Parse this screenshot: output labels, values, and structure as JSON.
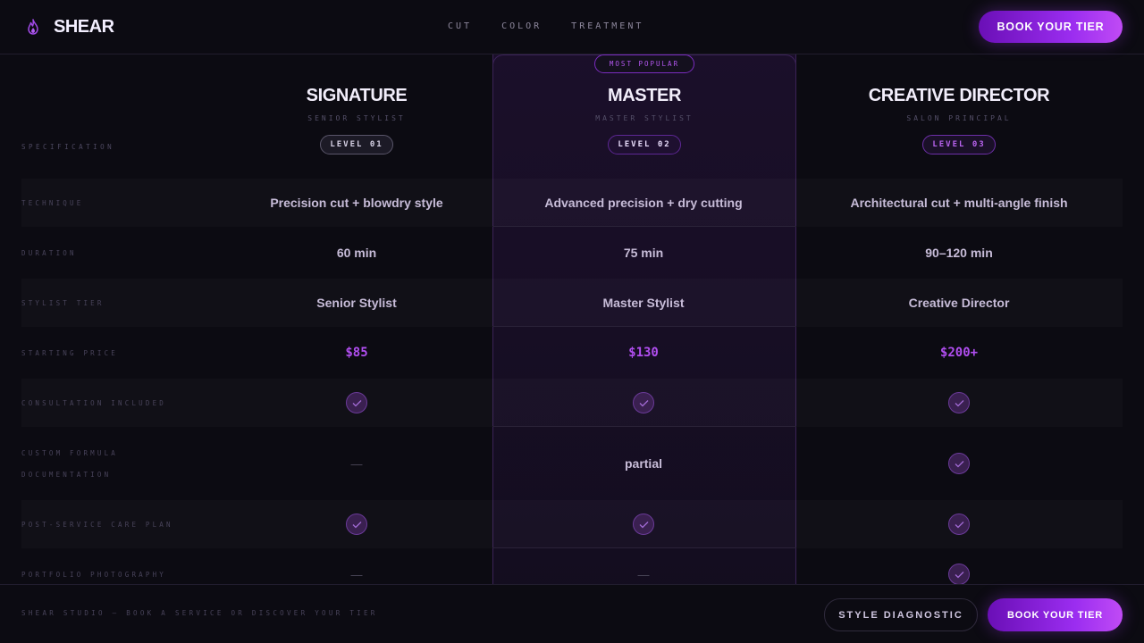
{
  "header": {
    "brand": "SHEAR",
    "nav": [
      "CUT",
      "COLOR",
      "TREATMENT"
    ],
    "cta": "BOOK YOUR TIER"
  },
  "table": {
    "spec_label": "SPECIFICATION",
    "popular_badge": "MOST POPULAR",
    "tiers": [
      {
        "name": "SIGNATURE",
        "subtitle": "SENIOR STYLIST",
        "level": "LEVEL 01"
      },
      {
        "name": "MASTER",
        "subtitle": "MASTER STYLIST",
        "level": "LEVEL 02"
      },
      {
        "name": "CREATIVE DIRECTOR",
        "subtitle": "SALON PRINCIPAL",
        "level": "LEVEL 03"
      }
    ],
    "rows": [
      {
        "label": "TECHNIQUE",
        "values": [
          "Precision cut + blowdry style",
          "Advanced precision + dry cutting",
          "Architectural cut + multi-angle finish"
        ]
      },
      {
        "label": "DURATION",
        "values": [
          "60 min",
          "75 min",
          "90–120 min"
        ]
      },
      {
        "label": "STYLIST TIER",
        "values": [
          "Senior Stylist",
          "Master Stylist",
          "Creative Director"
        ]
      },
      {
        "label": "STARTING PRICE",
        "values": [
          "$85",
          "$130",
          "$200+"
        ]
      },
      {
        "label": "CONSULTATION INCLUDED",
        "values": [
          "check",
          "check",
          "check"
        ]
      },
      {
        "label_line1": "CUSTOM FORMULA",
        "label_line2": "DOCUMENTATION",
        "values": [
          "—",
          "partial",
          "check"
        ]
      },
      {
        "label": "POST-SERVICE CARE PLAN",
        "values": [
          "check",
          "check",
          "check"
        ]
      },
      {
        "label": "PORTFOLIO PHOTOGRAPHY",
        "values": [
          "—",
          "—",
          "check"
        ]
      }
    ]
  },
  "footer": {
    "text": "SHEAR STUDIO — BOOK A SERVICE OR DISCOVER YOUR TIER",
    "secondary_button": "STYLE DIAGNOSTIC",
    "primary_button": "BOOK YOUR TIER"
  },
  "icons": {
    "brand": "flame-icon",
    "included": "check-icon"
  },
  "colors": {
    "accent": "#b14ef0",
    "background": "#0c0b12",
    "button_gradient_start": "#6a0fb6",
    "button_gradient_end": "#c04bf5"
  }
}
